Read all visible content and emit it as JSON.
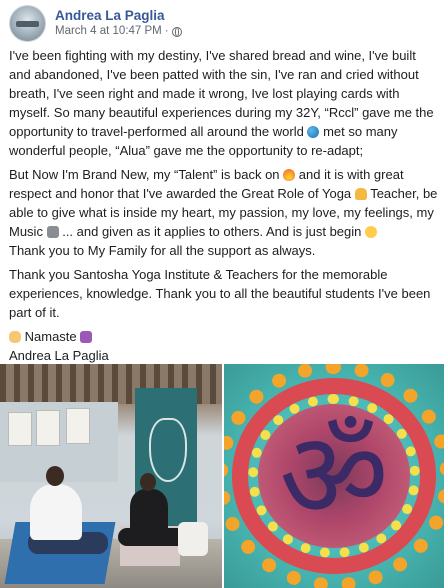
{
  "post": {
    "author": "Andrea La Paglia",
    "timestamp": "March 4 at 10:47 PM",
    "separator": "·",
    "privacy_icon": "globe-icon"
  },
  "text": {
    "p1": {
      "a": "I've been fighting with my destiny, I've shared bread and wine, I've built and abandoned, I've been patted with the sin, I've ran and cried without breath, I've seen right and made it wrong, Ive lost playing cards with myself. So many beautiful experiences during my 32Y, “Rccl” gave me the opportunity to travel-performed all around the world",
      "b": "met so many wonderful people, “Alua” gave me the opportunity to re-adapt;"
    },
    "p2": {
      "a": "But Now I'm Brand New, my “Talent” is back on",
      "b": "and it is with great respect and honor that I've awarded the Great Role of Yoga",
      "c": "Teacher, be able to give what is inside my heart, my passion, my love, my feelings, my Music",
      "d": "... and given as it applies to others. And is just begin",
      "e": "Thank you to My Family for all the support as always."
    },
    "p3": "Thank you Santosha Yoga Institute & Teachers for the memorable experiences, knowledge. Thank you to all the beautiful students I've been part of it.",
    "namaste": "Namaste",
    "signature": "Andrea La Paglia"
  },
  "emoji": {
    "globe": "globe-emoji",
    "fire": "fire-emoji",
    "yoga": "person-in-lotus-position-emoji",
    "music": "musical-score-emoji",
    "star_struck": "star-struck-emoji",
    "pray": "folded-hands-emoji",
    "om": "om-symbol-emoji"
  },
  "photos": [
    {
      "name": "yoga-class-photo"
    },
    {
      "name": "om-flower-mandala-photo"
    }
  ],
  "colors": {
    "author_link": "#385898",
    "meta_text": "#616770",
    "body_text": "#1c1e21"
  }
}
